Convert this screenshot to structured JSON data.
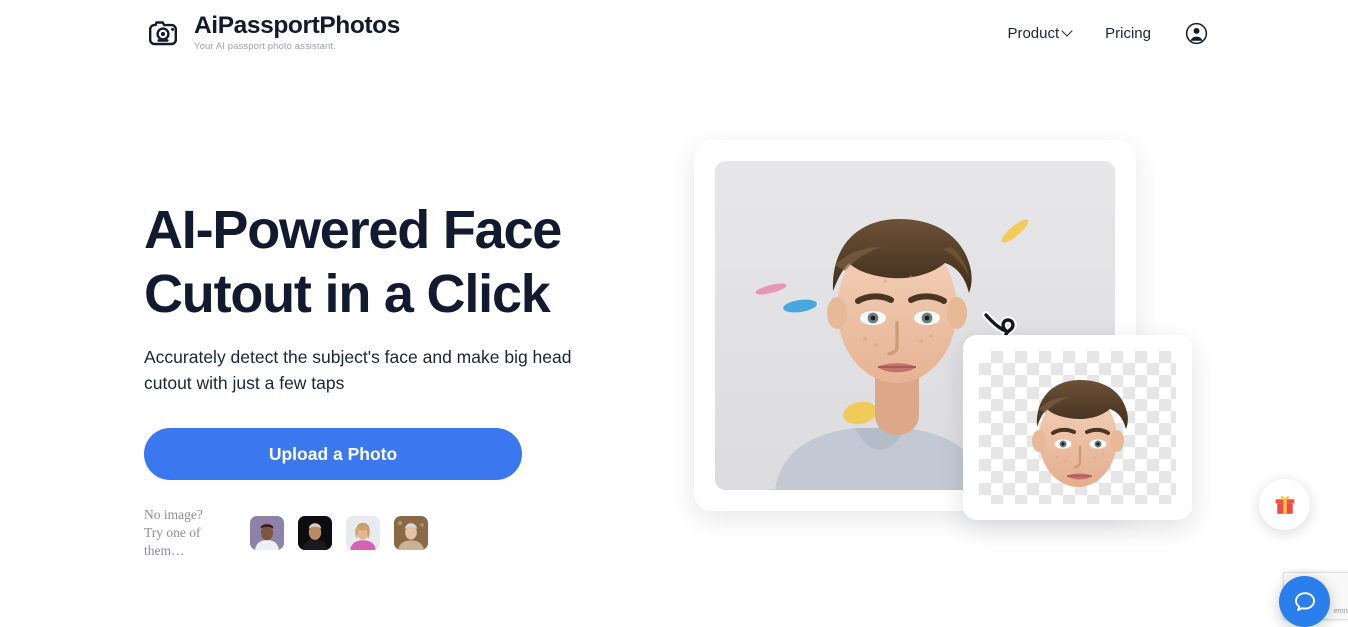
{
  "header": {
    "brand_name": "AiPassportPhotos",
    "brand_tagline": "Your AI passport photo assistant.",
    "logo_icon": "camera-icon",
    "nav": {
      "product_label": "Product",
      "product_chevron": "chevron-down-icon",
      "pricing_label": "Pricing",
      "account_icon": "account-circle-icon"
    }
  },
  "hero": {
    "title_line1": "AI-Powered Face",
    "title_line2": "Cutout in a Click",
    "subtitle": "Accurately detect the subject's face and make big head cutout with just a few taps",
    "upload_button_label": "Upload a Photo",
    "samples": {
      "label_line1": "No image?",
      "label_line2": "Try one of them…",
      "thumbnails": [
        {
          "name": "sample-photo-1",
          "background": "#8d83a8",
          "skin": "#7a5540",
          "hair": "#1d1d22",
          "accent": "#d33b30",
          "clothing": "#eceff3"
        },
        {
          "name": "sample-photo-2",
          "background": "#0d0d0f",
          "skin": "#b98a68",
          "hair": "#d8cfc2",
          "accent": "#0d0d0f",
          "clothing": "#1a1a1e"
        },
        {
          "name": "sample-photo-3",
          "background": "#e9eaee",
          "skin": "#e3b592",
          "hair": "#caa06a",
          "accent": "#d662b4",
          "clothing": "#d662b4"
        },
        {
          "name": "sample-photo-4",
          "background": "#8a6a46",
          "skin": "#e6c3a6",
          "hair": "#d9d9dc",
          "accent": "#b69a77",
          "clothing": "#c9b296"
        }
      ]
    },
    "visual": {
      "original_photo_alt": "Portrait of a young man on a light gray background with confetti",
      "cutout_photo_alt": "Cut out face on transparent checkerboard background",
      "arrow_icon": "curved-arrow-doodle-icon",
      "confetti_colors": [
        "#f2c94c",
        "#2d9cdb",
        "#eb5a8c",
        "#f2c94c",
        "#2d9cdb"
      ]
    }
  },
  "widgets": {
    "gift_button_icon": "gift-icon",
    "chat_button_icon": "chat-bubble-icon",
    "recaptcha_terms_label": "erms",
    "recaptcha_logo_icon": "recaptcha-icon"
  },
  "colors": {
    "accent_blue": "#3b78f0",
    "chat_blue": "#2a7fec",
    "ink": "#111a2e",
    "muted": "#8d8d97"
  }
}
